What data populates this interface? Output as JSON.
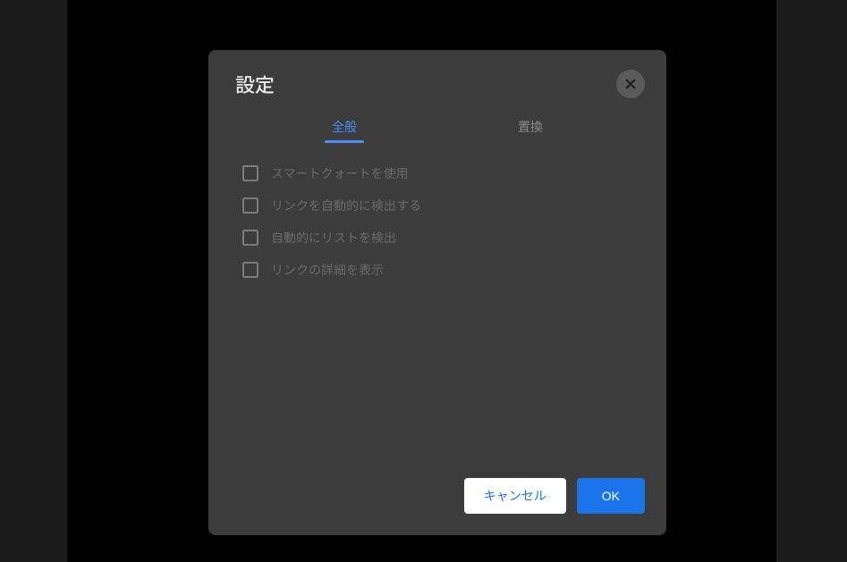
{
  "dialog": {
    "title": "設定",
    "tabs": {
      "general": "全般",
      "replace": "置換"
    },
    "options": [
      {
        "label": "スマートクォートを使用"
      },
      {
        "label": "リンクを自動的に検出する"
      },
      {
        "label": "自動的にリストを検出"
      },
      {
        "label": "リンクの詳細を表示"
      }
    ],
    "buttons": {
      "cancel": "キャンセル",
      "ok": "OK"
    }
  }
}
